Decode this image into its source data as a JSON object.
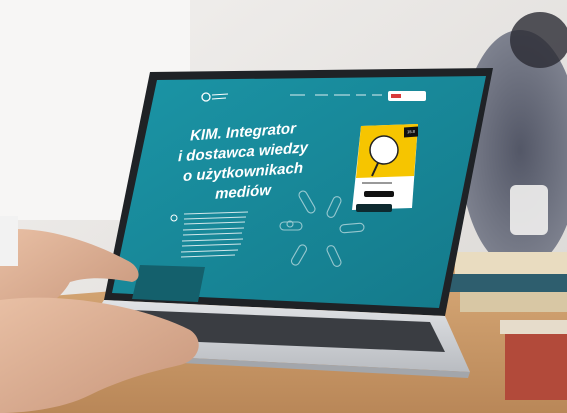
{
  "headline": {
    "line1": "KIM. Integrator",
    "line2": "i dostawca wiedzy",
    "line3": "o użytkownikach",
    "line4": "mediów"
  },
  "card": {
    "badge": "15.8"
  },
  "colors": {
    "screen_teal": "#1a8fa0",
    "card_yellow": "#f6c500",
    "wall": "#ece9e6",
    "desk": "#c89a6a",
    "laptop_silver": "#cfd2d6"
  }
}
